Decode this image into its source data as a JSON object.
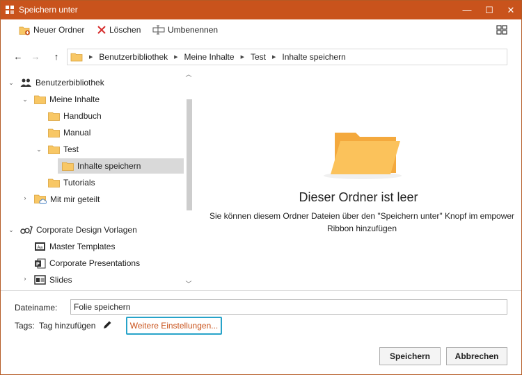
{
  "window": {
    "title": "Speichern unter",
    "minimize": "—",
    "maximize": "☐",
    "close": "✕"
  },
  "toolbar": {
    "new_folder": "Neuer Ordner",
    "delete": "Löschen",
    "rename": "Umbenennen"
  },
  "nav": {
    "back": "←",
    "forward": "→",
    "up": "↑",
    "breadcrumbs": [
      "Benutzerbibliothek",
      "Meine Inhalte",
      "Test",
      "Inhalte speichern"
    ]
  },
  "tree": {
    "user_library": "Benutzerbibliothek",
    "my_content": "Meine Inhalte",
    "handbuch": "Handbuch",
    "manual": "Manual",
    "test": "Test",
    "save_content": "Inhalte speichern",
    "tutorials": "Tutorials",
    "shared_with_me": "Mit mir geteilt",
    "cd_templates": "Corporate Design Vorlagen",
    "master_templates": "Master Templates",
    "corporate_presentations": "Corporate Presentations",
    "slides": "Slides"
  },
  "empty_state": {
    "title": "Dieser Ordner ist leer",
    "line1": "Sie können diesem Ordner Dateien über den \"Speichern unter\" Knopf im empower",
    "line2": "Ribbon hinzufügen"
  },
  "form": {
    "filename_label": "Dateiname:",
    "filename_value": "Folie speichern",
    "tags_label": "Tags:",
    "add_tag": "Tag hinzufügen",
    "more_settings": "Weitere Einstellungen...",
    "save": "Speichern",
    "cancel": "Abbrechen"
  },
  "colors": {
    "titlebar": "#c9531c",
    "link": "#c9531c",
    "highlight_border": "#27a3c9",
    "folder": "#f8c765"
  }
}
